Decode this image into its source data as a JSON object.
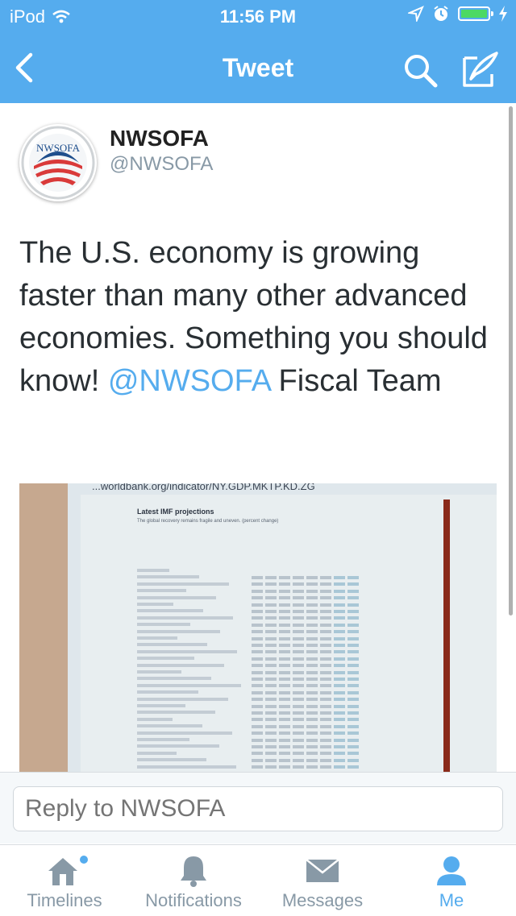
{
  "status_bar": {
    "carrier": "iPod",
    "time": "11:56 PM",
    "battery_level": 1.0,
    "icons": [
      "wifi-icon",
      "location-arrow-icon",
      "alarm-icon",
      "battery-icon",
      "charging-bolt-icon"
    ]
  },
  "nav": {
    "title": "Tweet",
    "back_icon": "back-chevron-icon",
    "search_icon": "search-icon",
    "compose_icon": "compose-tweet-icon"
  },
  "tweet": {
    "avatar_text": "NWSOFA",
    "name": "NWSOFA",
    "handle": "@NWSOFA",
    "text_before": "The U.S. economy is growing faster than many other advanced economies. Something you should know! ",
    "mention": "@NWSOFA",
    "text_after": " Fiscal Team"
  },
  "media": {
    "url_text": "...worldbank.org/indicator/NY.GDP.MKTP.KD.ZG",
    "slide_title": "Latest IMF projections",
    "slide_subtitle": "The global recovery remains fragile and uneven. (percent change)"
  },
  "reply": {
    "placeholder": "Reply to NWSOFA"
  },
  "tabs": [
    {
      "label": "Timelines",
      "icon": "home-icon",
      "active": false,
      "has_badge": true
    },
    {
      "label": "Notifications",
      "icon": "bell-icon",
      "active": false,
      "has_badge": false
    },
    {
      "label": "Messages",
      "icon": "envelope-icon",
      "active": false,
      "has_badge": false
    },
    {
      "label": "Me",
      "icon": "person-icon",
      "active": true,
      "has_badge": false
    }
  ],
  "colors": {
    "brand": "#55acee",
    "tab_inactive": "#8899a6",
    "text": "#292f33"
  }
}
